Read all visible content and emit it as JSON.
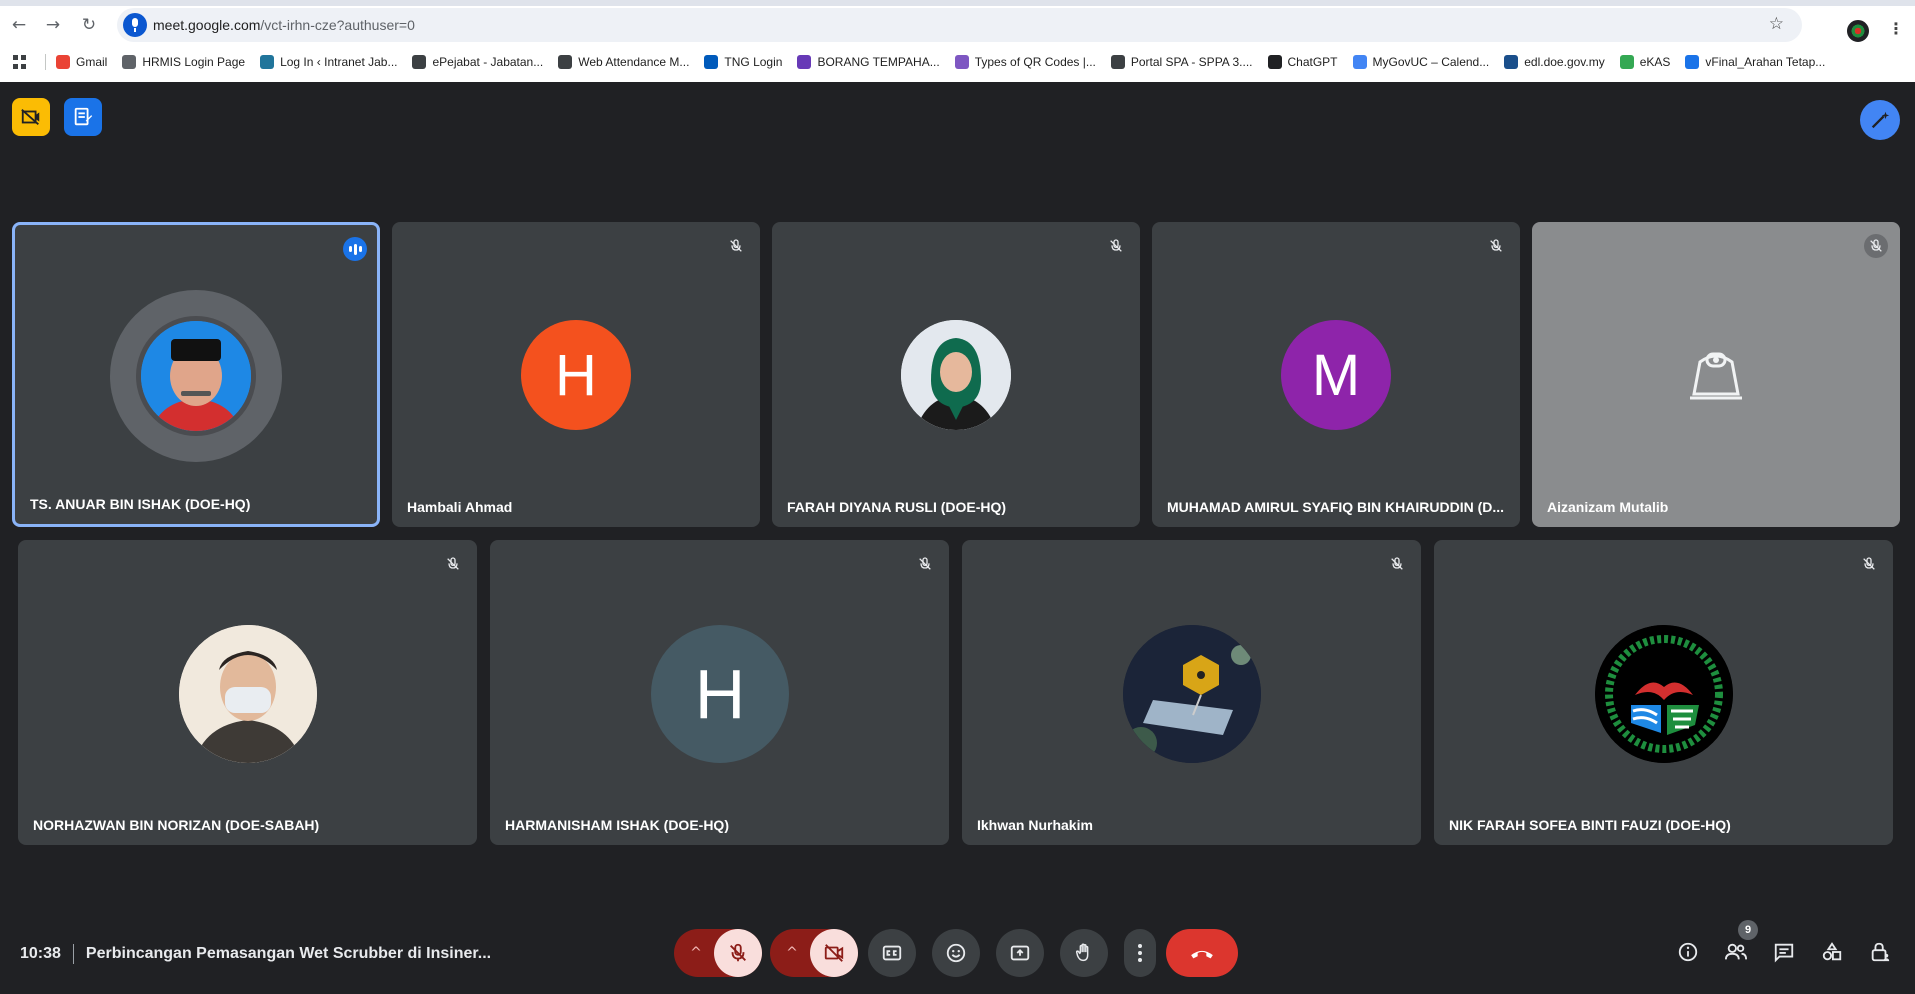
{
  "browser": {
    "url_host": "meet.google.com",
    "url_path": "/vct-irhn-cze?authuser=0",
    "back_icon": "arrow-left-icon",
    "forward_icon": "arrow-right-icon",
    "reload_icon": "reload-icon",
    "bookmarks": [
      {
        "label": "Gmail",
        "color": "#ea4335"
      },
      {
        "label": "HRMIS Login Page",
        "color": "#5f6368"
      },
      {
        "label": "Log In ‹ Intranet Jab...",
        "color": "#21759b"
      },
      {
        "label": "ePejabat - Jabatan...",
        "color": "#3c4043"
      },
      {
        "label": "Web Attendance M...",
        "color": "#3c4043"
      },
      {
        "label": "TNG Login",
        "color": "#005abb"
      },
      {
        "label": "BORANG TEMPAHA...",
        "color": "#673ab7"
      },
      {
        "label": "Types of QR Codes |...",
        "color": "#7e57c2"
      },
      {
        "label": "Portal SPA - SPPA 3....",
        "color": "#3c4043"
      },
      {
        "label": "ChatGPT",
        "color": "#202124"
      },
      {
        "label": "MyGovUC – Calend...",
        "color": "#4285f4"
      },
      {
        "label": "edl.doe.gov.my",
        "color": "#1a4f8b"
      },
      {
        "label": "eKAS",
        "color": "#34a853"
      },
      {
        "label": "vFinal_Arahan Tetap...",
        "color": "#1a73e8"
      }
    ]
  },
  "meet": {
    "participants_row1": [
      {
        "name": "TS. ANUAR BIN ISHAK (DOE-HQ)",
        "avatar": "photo",
        "speaking": true
      },
      {
        "name": "Hambali Ahmad",
        "avatar_letter": "H",
        "avatar_color": "#f4511e"
      },
      {
        "name": "FARAH DIYANA RUSLI (DOE-HQ)",
        "avatar": "photo"
      },
      {
        "name": "MUHAMAD AMIRUL SYAFIQ BIN KHAIRUDDIN (D...",
        "avatar_letter": "M",
        "avatar_color": "#8e24aa"
      },
      {
        "name": "Aizanizam Mutalib",
        "avatar": "webcam-icon"
      }
    ],
    "participants_row2": [
      {
        "name": "NORHAZWAN BIN NORIZAN (DOE-SABAH)",
        "avatar": "photo"
      },
      {
        "name": "HARMANISHAM ISHAK (DOE-HQ)",
        "avatar_letter": "H",
        "avatar_color": "#455a64"
      },
      {
        "name": "Ikhwan Nurhakim",
        "avatar": "photo"
      },
      {
        "name": "NIK FARAH SOFEA BINTI FAUZI (DOE-HQ)",
        "avatar": "logo"
      }
    ],
    "time": "10:38",
    "meeting_title": "Perbincangan Pemasangan Wet Scrubber di Insiner...",
    "participant_count": "9"
  }
}
